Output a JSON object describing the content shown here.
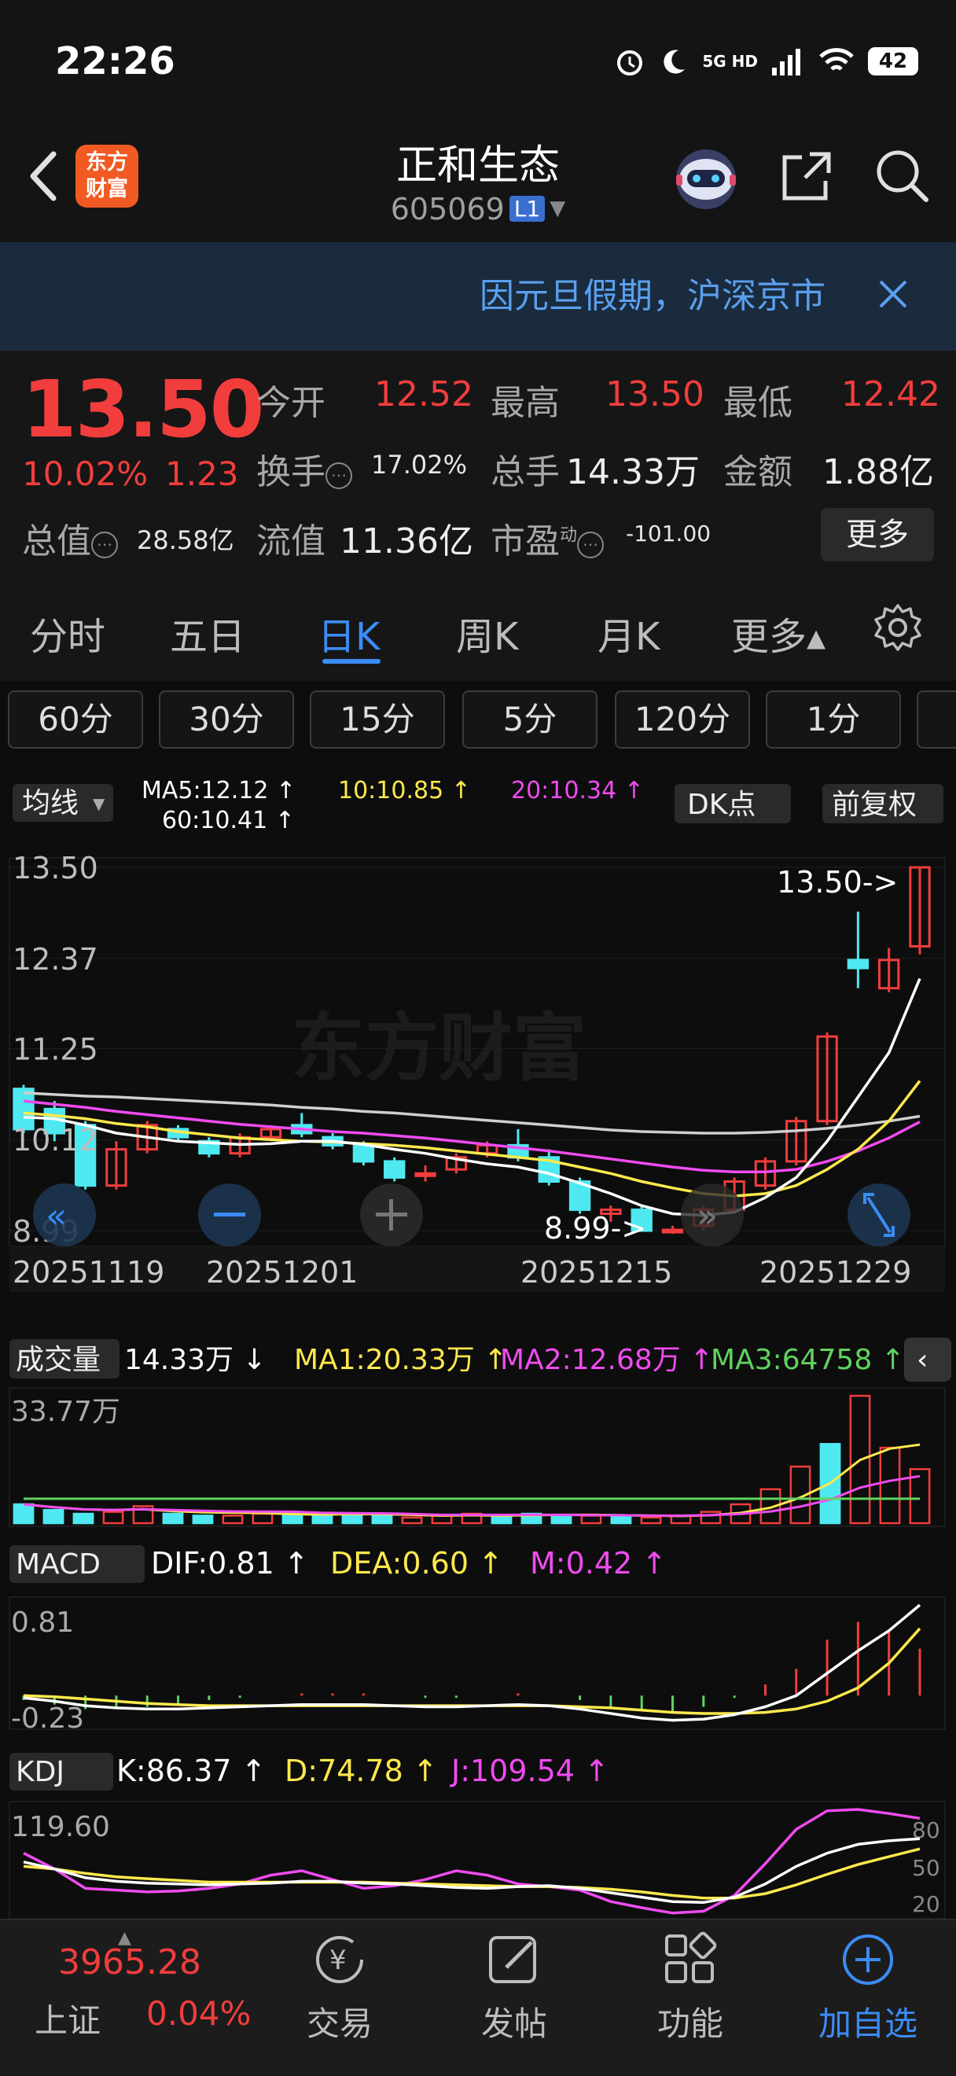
{
  "status_bar": {
    "time": "22:26",
    "network": "5G HD",
    "battery": "42"
  },
  "header": {
    "logo_line1": "东方",
    "logo_line2": "财富",
    "stock_name": "正和生态",
    "stock_code": "605069",
    "level_badge": "L1"
  },
  "notice": {
    "text": "因元旦假期，沪深京市"
  },
  "quote": {
    "price": "13.50",
    "change_pct": "10.02%",
    "change": "1.23",
    "open_label": "今开",
    "open": "12.52",
    "high_label": "最高",
    "high": "13.50",
    "low_label": "最低",
    "low": "12.42",
    "turnover_label": "换手",
    "turnover": "17.02%",
    "volume_label": "总手",
    "volume": "14.33万",
    "amount_label": "金额",
    "amount": "1.88亿",
    "mktcap_label": "总值",
    "mktcap": "28.58亿",
    "float_label": "流值",
    "float_cap": "11.36亿",
    "pe_label": "市盈",
    "pe_sup": "动",
    "pe": "-101.00",
    "more": "更多"
  },
  "tabs": [
    "分时",
    "五日",
    "日K",
    "周K",
    "月K",
    "更多▴"
  ],
  "active_tab": "日K",
  "periods": [
    "60分",
    "30分",
    "15分",
    "5分",
    "120分",
    "1分"
  ],
  "kline": {
    "ma_label": "均线",
    "ma5": "MA5:12.12 ↑",
    "ma10": "10:10.85 ↑",
    "ma20": "20:10.34 ↑",
    "ma60": "60:10.41 ↑",
    "dk_label": "DK点",
    "adjust_label": "前复权",
    "y_labels": [
      "13.50",
      "12.37",
      "11.25",
      "10.12",
      "8.99"
    ],
    "high_marker": "13.50->",
    "low_marker": "8.99->",
    "dates": [
      "20251119",
      "20251201",
      "20251215",
      "20251229"
    ],
    "watermark": "东方财富"
  },
  "volume_panel": {
    "label": "成交量",
    "value": "14.33万 ↓",
    "ma1": "MA1:20.33万 ↑",
    "ma2": "MA2:12.68万 ↑",
    "ma3": "MA3:64758 ↑",
    "y_max": "33.77万"
  },
  "macd_panel": {
    "label": "MACD",
    "dif": "DIF:0.81 ↑",
    "dea": "DEA:0.60 ↑",
    "m": "M:0.42 ↑",
    "y_top": "0.81",
    "y_bottom": "-0.23"
  },
  "kdj_panel": {
    "label": "KDJ",
    "k": "K:86.37 ↑",
    "d": "D:74.78 ↑",
    "j": "J:109.54 ↑",
    "y_top": "119.60",
    "levels": [
      "80",
      "50",
      "20"
    ]
  },
  "bottom_nav": {
    "index_value": "3965.28",
    "index_name": "上证",
    "index_pct": "0.04%",
    "items": [
      "交易",
      "发帖",
      "功能",
      "加自选"
    ]
  },
  "colors": {
    "up": "#f23d3d",
    "down": "#4ee8f0",
    "accent": "#3b8cf5",
    "ma5": "#ffffff",
    "ma10": "#ffe94d",
    "ma20": "#f04bf0",
    "ma60": "#cfcfcf"
  },
  "chart_data": {
    "type": "candlestick",
    "dates": [
      "20251119",
      "20251201",
      "20251215",
      "20251229"
    ],
    "ylim": [
      8.99,
      13.5
    ],
    "candles": [
      {
        "o": 10.75,
        "c": 10.25,
        "h": 10.8,
        "l": 10.2
      },
      {
        "o": 10.5,
        "c": 10.2,
        "h": 10.6,
        "l": 10.1
      },
      {
        "o": 10.3,
        "c": 9.55,
        "h": 10.35,
        "l": 9.5
      },
      {
        "o": 9.55,
        "c": 10.0,
        "h": 10.1,
        "l": 9.5
      },
      {
        "o": 10.0,
        "c": 10.3,
        "h": 10.35,
        "l": 9.95
      },
      {
        "o": 10.25,
        "c": 10.15,
        "h": 10.3,
        "l": 10.1
      },
      {
        "o": 10.1,
        "c": 9.95,
        "h": 10.15,
        "l": 9.9
      },
      {
        "o": 9.95,
        "c": 10.15,
        "h": 10.2,
        "l": 9.9
      },
      {
        "o": 10.15,
        "c": 10.25,
        "h": 10.3,
        "l": 10.1
      },
      {
        "o": 10.3,
        "c": 10.2,
        "h": 10.45,
        "l": 10.15
      },
      {
        "o": 10.15,
        "c": 10.05,
        "h": 10.2,
        "l": 10.0
      },
      {
        "o": 10.05,
        "c": 9.85,
        "h": 10.1,
        "l": 9.8
      },
      {
        "o": 9.85,
        "c": 9.65,
        "h": 9.9,
        "l": 9.6
      },
      {
        "o": 9.7,
        "c": 9.7,
        "h": 9.8,
        "l": 9.6
      },
      {
        "o": 9.75,
        "c": 9.9,
        "h": 9.95,
        "l": 9.7
      },
      {
        "o": 9.95,
        "c": 10.05,
        "h": 10.1,
        "l": 9.9
      },
      {
        "o": 10.05,
        "c": 9.9,
        "h": 10.25,
        "l": 9.85
      },
      {
        "o": 9.9,
        "c": 9.6,
        "h": 10.0,
        "l": 9.55
      },
      {
        "o": 9.6,
        "c": 9.25,
        "h": 9.65,
        "l": 9.2
      },
      {
        "o": 9.2,
        "c": 9.25,
        "h": 9.3,
        "l": 9.1
      },
      {
        "o": 9.25,
        "c": 8.99,
        "h": 9.3,
        "l": 8.99
      },
      {
        "o": 9.0,
        "c": 9.0,
        "h": 9.05,
        "l": 8.95
      },
      {
        "o": 9.05,
        "c": 9.25,
        "h": 9.3,
        "l": 9.0
      },
      {
        "o": 9.25,
        "c": 9.6,
        "h": 9.65,
        "l": 9.2
      },
      {
        "o": 9.55,
        "c": 9.85,
        "h": 9.9,
        "l": 9.5
      },
      {
        "o": 9.85,
        "c": 10.35,
        "h": 10.4,
        "l": 9.8
      },
      {
        "o": 10.35,
        "c": 11.4,
        "h": 11.45,
        "l": 10.3
      },
      {
        "o": 12.35,
        "c": 12.25,
        "h": 12.95,
        "l": 12.0
      },
      {
        "o": 12.0,
        "c": 12.35,
        "h": 12.5,
        "l": 11.95
      },
      {
        "o": 12.52,
        "c": 13.5,
        "h": 13.5,
        "l": 12.42
      }
    ],
    "ma5": [
      10.4,
      10.38,
      10.3,
      10.2,
      10.15,
      10.1,
      10.08,
      10.06,
      10.07,
      10.1,
      10.1,
      10.06,
      10.0,
      9.95,
      9.88,
      9.82,
      9.78,
      9.7,
      9.58,
      9.45,
      9.3,
      9.2,
      9.18,
      9.22,
      9.4,
      9.65,
      10.1,
      10.65,
      11.2,
      12.12
    ],
    "ma10": [
      10.45,
      10.42,
      10.38,
      10.32,
      10.28,
      10.22,
      10.18,
      10.14,
      10.12,
      10.1,
      10.09,
      10.07,
      10.05,
      10.02,
      9.98,
      9.94,
      9.9,
      9.86,
      9.78,
      9.7,
      9.6,
      9.52,
      9.45,
      9.42,
      9.45,
      9.55,
      9.75,
      10.0,
      10.35,
      10.85
    ],
    "ma20": [
      10.6,
      10.56,
      10.52,
      10.47,
      10.43,
      10.39,
      10.35,
      10.31,
      10.28,
      10.25,
      10.22,
      10.2,
      10.17,
      10.14,
      10.1,
      10.06,
      10.02,
      9.98,
      9.93,
      9.88,
      9.83,
      9.78,
      9.74,
      9.72,
      9.72,
      9.75,
      9.85,
      9.98,
      10.14,
      10.34
    ],
    "ma60": [
      10.7,
      10.68,
      10.66,
      10.65,
      10.63,
      10.61,
      10.59,
      10.57,
      10.55,
      10.52,
      10.5,
      10.47,
      10.45,
      10.42,
      10.39,
      10.36,
      10.33,
      10.3,
      10.27,
      10.24,
      10.22,
      10.21,
      10.2,
      10.2,
      10.21,
      10.23,
      10.26,
      10.3,
      10.35,
      10.41
    ],
    "volume": [
      5.0,
      3.5,
      2.5,
      3.0,
      4.5,
      2.5,
      2.0,
      2.0,
      2.5,
      3.0,
      2.0,
      2.5,
      2.0,
      1.5,
      2.0,
      2.5,
      2.0,
      2.5,
      2.0,
      2.0,
      2.0,
      1.5,
      2.0,
      3.0,
      5.0,
      9.0,
      15.0,
      21.0,
      33.77,
      20.0,
      14.33
    ],
    "macd_dif": [
      -0.02,
      -0.05,
      -0.09,
      -0.11,
      -0.12,
      -0.12,
      -0.11,
      -0.1,
      -0.09,
      -0.08,
      -0.08,
      -0.08,
      -0.09,
      -0.1,
      -0.1,
      -0.09,
      -0.08,
      -0.09,
      -0.12,
      -0.16,
      -0.2,
      -0.22,
      -0.21,
      -0.17,
      -0.1,
      0.0,
      0.2,
      0.4,
      0.58,
      0.81
    ],
    "macd_dea": [
      0.0,
      -0.01,
      -0.03,
      -0.05,
      -0.07,
      -0.08,
      -0.09,
      -0.09,
      -0.09,
      -0.09,
      -0.09,
      -0.09,
      -0.09,
      -0.09,
      -0.09,
      -0.09,
      -0.09,
      -0.09,
      -0.1,
      -0.11,
      -0.13,
      -0.15,
      -0.16,
      -0.16,
      -0.15,
      -0.12,
      -0.05,
      0.07,
      0.29,
      0.6
    ],
    "kdj_k": [
      60,
      52,
      42,
      38,
      36,
      35,
      34,
      35,
      36,
      38,
      38,
      36,
      35,
      33,
      31,
      30,
      32,
      33,
      30,
      25,
      20,
      15,
      14,
      20,
      35,
      55,
      70,
      80,
      84,
      86.37
    ],
    "kdj_d": [
      55,
      52,
      47,
      43,
      41,
      39,
      37,
      37,
      37,
      37,
      37,
      37,
      36,
      35,
      34,
      33,
      32,
      32,
      31,
      29,
      26,
      22,
      19,
      19,
      24,
      34,
      46,
      57,
      66,
      74.78
    ],
    "kdj_j": [
      70,
      52,
      30,
      28,
      26,
      27,
      30,
      35,
      45,
      50,
      40,
      30,
      33,
      40,
      50,
      45,
      35,
      32,
      28,
      15,
      8,
      2,
      4,
      22,
      58,
      97,
      118,
      119.6,
      115,
      109.54
    ]
  }
}
